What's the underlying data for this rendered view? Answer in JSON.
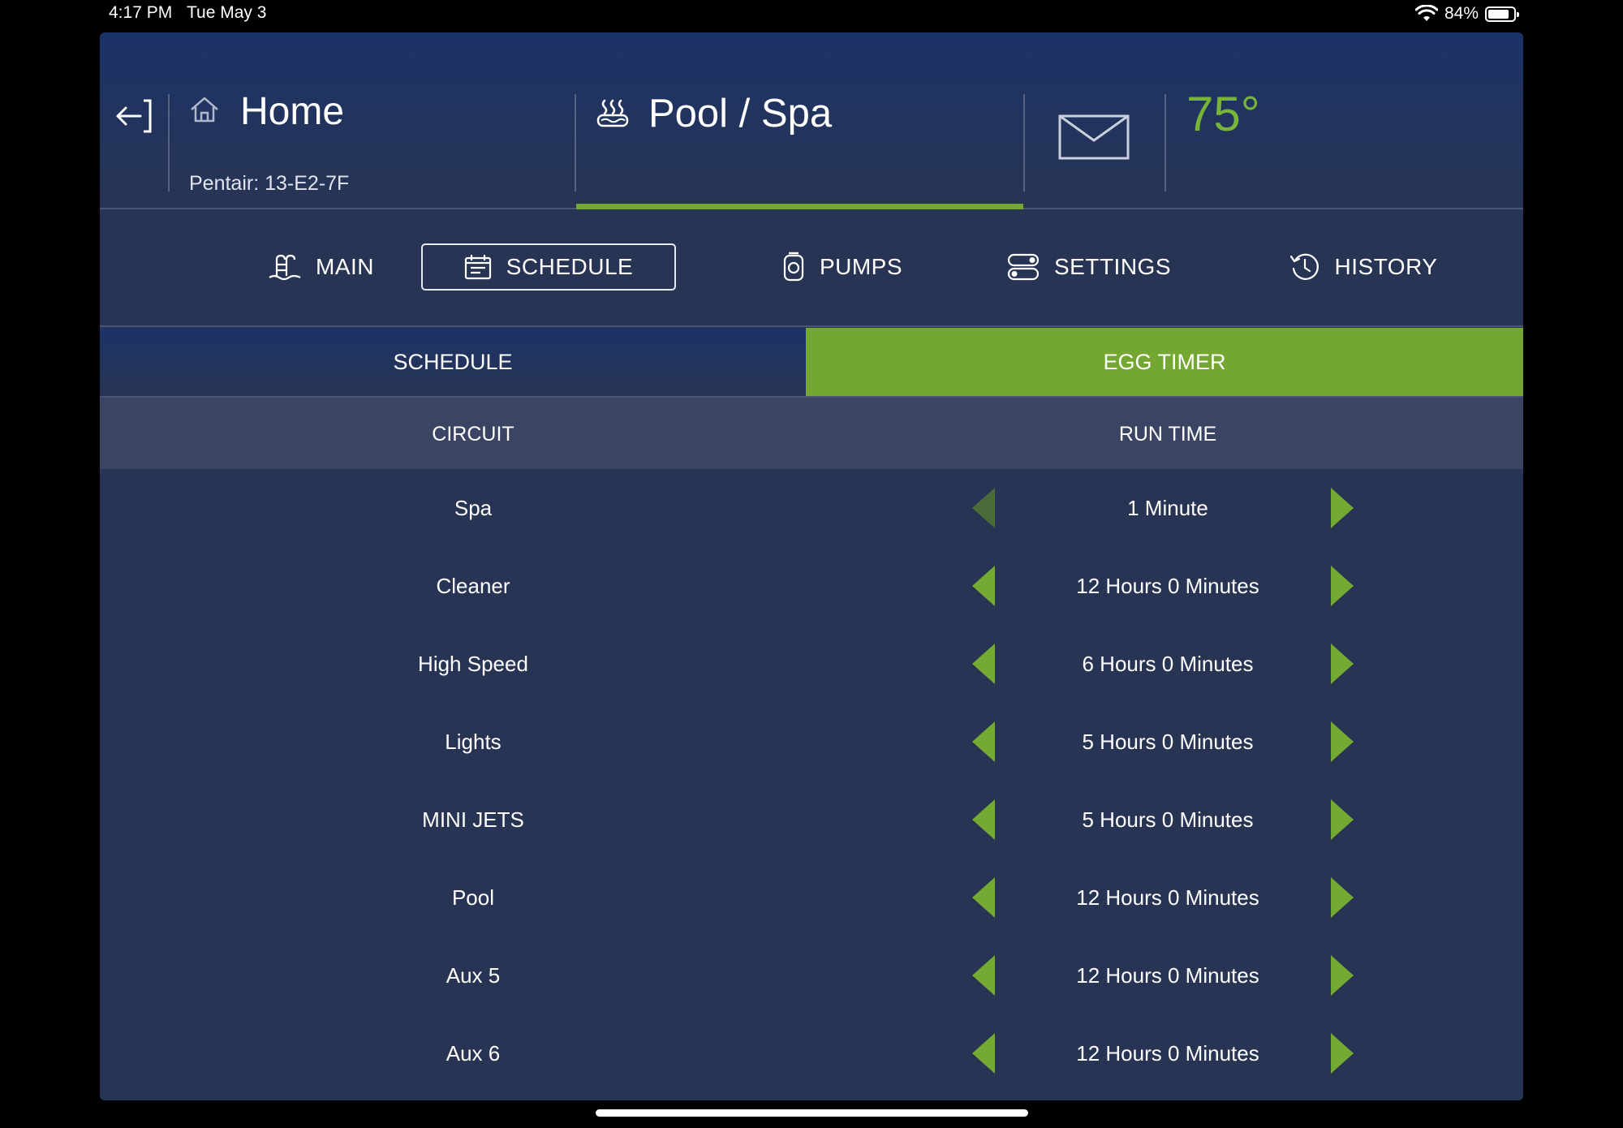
{
  "status_bar": {
    "time": "4:17 PM",
    "date": "Tue May 3",
    "battery": "84%",
    "battery_level": 0.84
  },
  "header": {
    "exit_icon": "exit-icon",
    "home_title": "Home",
    "home_subtitle": "Pentair: 13-E2-7F",
    "pool_title": "Pool / Spa",
    "temperature": "75°",
    "colors": {
      "accent": "#73a732",
      "temp": "#77b43a",
      "background": "#283454",
      "header_top": "#1c3368"
    }
  },
  "nav": {
    "items": [
      {
        "label": "MAIN",
        "icon": "pool-ladder-icon"
      },
      {
        "label": "SCHEDULE",
        "icon": "calendar-icon",
        "active": true
      },
      {
        "label": "PUMPS",
        "icon": "pump-icon"
      },
      {
        "label": "SETTINGS",
        "icon": "toggles-icon"
      },
      {
        "label": "HISTORY",
        "icon": "history-icon"
      }
    ]
  },
  "subtabs": {
    "schedule": "SCHEDULE",
    "egg_timer": "EGG TIMER",
    "selected": "EGG TIMER"
  },
  "table": {
    "headers": {
      "circuit": "CIRCUIT",
      "run_time": "RUN TIME"
    },
    "rows": [
      {
        "circuit": "Spa",
        "run_time": "1 Minute",
        "decrement_disabled": true
      },
      {
        "circuit": "Cleaner",
        "run_time": "12 Hours 0 Minutes"
      },
      {
        "circuit": "High Speed",
        "run_time": "6 Hours 0 Minutes"
      },
      {
        "circuit": "Lights",
        "run_time": "5 Hours 0 Minutes"
      },
      {
        "circuit": "MINI JETS",
        "run_time": "5 Hours 0 Minutes"
      },
      {
        "circuit": "Pool",
        "run_time": "12 Hours 0 Minutes"
      },
      {
        "circuit": "Aux 5",
        "run_time": "12 Hours 0 Minutes"
      },
      {
        "circuit": "Aux 6",
        "run_time": "12 Hours 0 Minutes"
      }
    ]
  }
}
